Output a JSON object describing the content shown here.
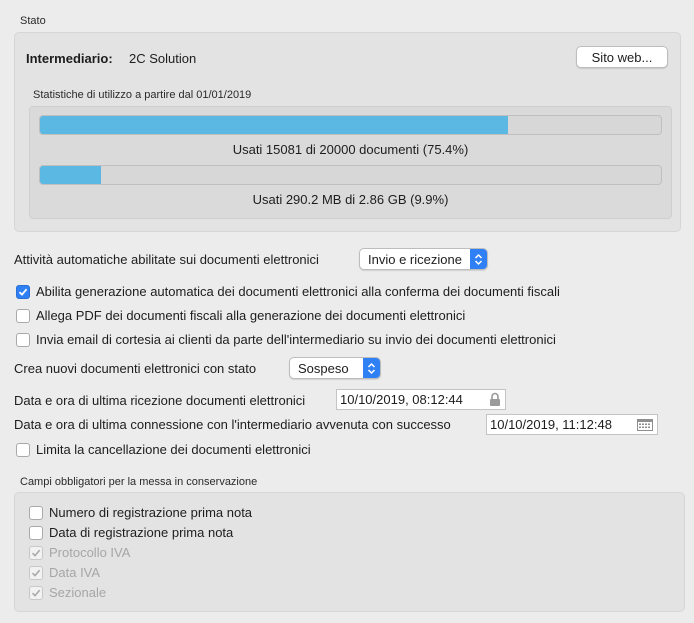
{
  "stato": {
    "title": "Stato",
    "intermediario_label": "Intermediario:",
    "intermediario_value": "2C Solution",
    "sito_web_label": "Sito web...",
    "stats_title": "Statistiche di utilizzo a partire dal 01/01/2019",
    "doc_usage": {
      "caption": "Usati 15081 di 20000 documenti (75.4%)",
      "fraction": 0.754
    },
    "storage_usage": {
      "caption": "Usati 290.2 MB di 2.86 GB (9.9%)",
      "fraction": 0.099
    }
  },
  "attivita": {
    "label": "Attività automatiche abilitate sui documenti elettronici",
    "selected": "Invio e ricezione"
  },
  "options": [
    {
      "label": "Abilita generazione automatica dei documenti elettronici alla conferma dei documenti fiscali",
      "checked": true
    },
    {
      "label": "Allega PDF dei documenti fiscali alla generazione dei documenti elettronici",
      "checked": false
    },
    {
      "label": "Invia email di cortesia ai clienti da parte dell'intermediario su invio dei documenti elettronici",
      "checked": false
    }
  ],
  "crea_stato": {
    "label": "Crea nuovi documenti elettronici con stato",
    "selected": "Sospeso"
  },
  "ultima_ricezione": {
    "label": "Data e ora di ultima ricezione documenti elettronici",
    "value": "10/10/2019, 08:12:44"
  },
  "ultima_connessione": {
    "label": "Data e ora di ultima connessione con l'intermediario avvenuta con successo",
    "value": "10/10/2019, 11:12:48"
  },
  "limita_cancellazione": {
    "label": "Limita la cancellazione dei documenti elettronici",
    "checked": false
  },
  "conservazione": {
    "title": "Campi obbligatori per la messa in conservazione",
    "items": [
      {
        "label": "Numero di registrazione prima nota",
        "checked": false,
        "disabled": false
      },
      {
        "label": "Data di registrazione prima nota",
        "checked": false,
        "disabled": false
      },
      {
        "label": "Protocollo IVA",
        "checked": true,
        "disabled": true
      },
      {
        "label": "Data IVA",
        "checked": true,
        "disabled": true
      },
      {
        "label": "Sezionale",
        "checked": true,
        "disabled": true
      }
    ]
  },
  "colors": {
    "accent": "#2f7ff5",
    "progress": "#5ab8e2"
  }
}
